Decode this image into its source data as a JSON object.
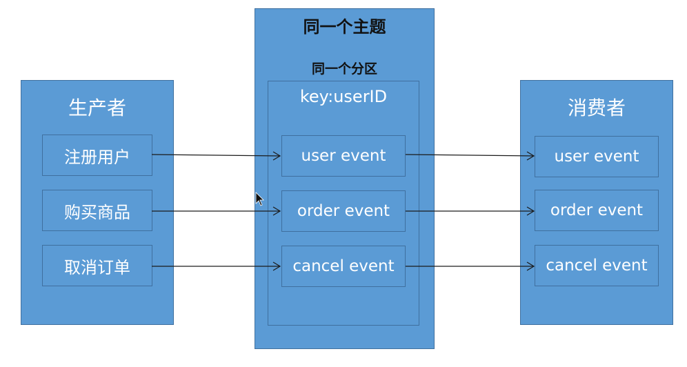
{
  "producer": {
    "title": "生产者",
    "items": [
      "注册用户",
      "购买商品",
      "取消订单"
    ]
  },
  "topic": {
    "title": "同一个主题",
    "partition_title": "同一个分区",
    "key_label": "key:userID",
    "events": [
      "user event",
      "order event",
      "cancel event"
    ]
  },
  "consumer": {
    "title": "消费者",
    "events": [
      "user event",
      "order event",
      "cancel event"
    ]
  },
  "colors": {
    "panel_fill": "#5b9bd5",
    "border": "#3f6f9e",
    "arrow": "#1a1a1a"
  }
}
